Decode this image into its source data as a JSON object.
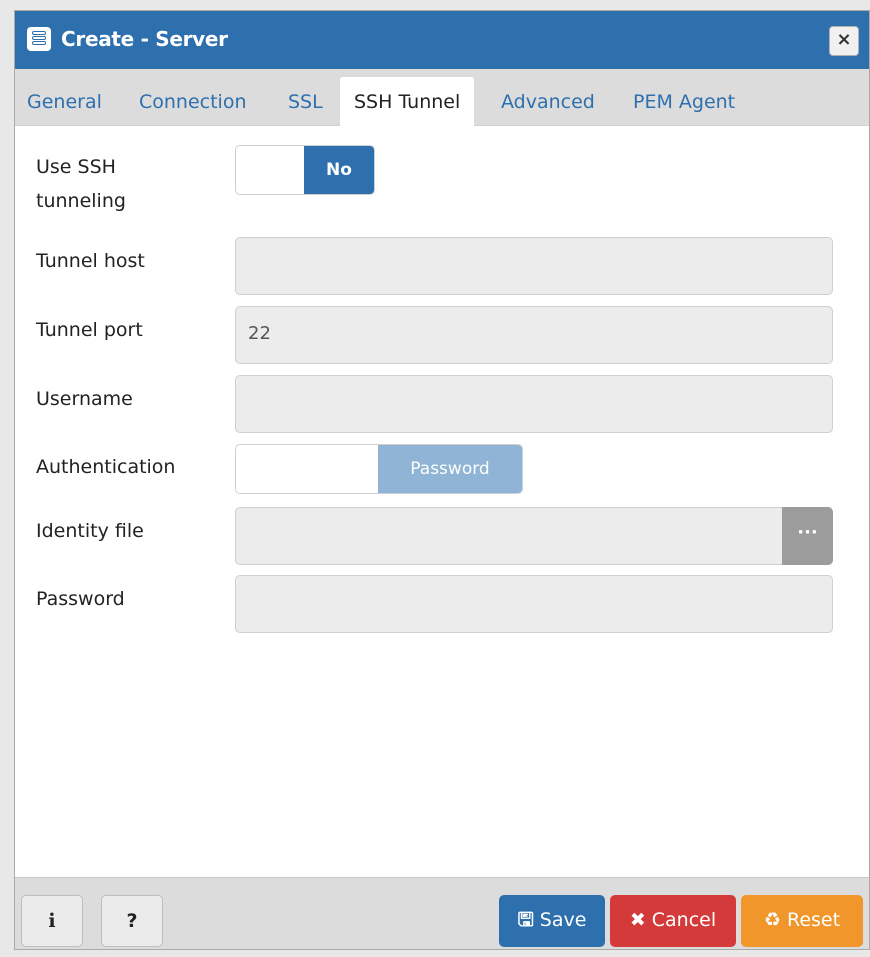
{
  "dialog": {
    "title": "Create - Server",
    "close_glyph": "×"
  },
  "tabs": [
    {
      "label": "General"
    },
    {
      "label": "Connection"
    },
    {
      "label": "SSL"
    },
    {
      "label": "SSH Tunnel",
      "active": true
    },
    {
      "label": "Advanced"
    },
    {
      "label": "PEM Agent"
    }
  ],
  "form": {
    "use_ssh": {
      "label_line1": "Use SSH",
      "label_line2": "tunneling",
      "value": "No"
    },
    "tunnel_host": {
      "label": "Tunnel host",
      "value": ""
    },
    "tunnel_port": {
      "label": "Tunnel port",
      "value": "22"
    },
    "username": {
      "label": "Username",
      "value": ""
    },
    "authentication": {
      "label": "Authentication",
      "value": "Password"
    },
    "identity_file": {
      "label": "Identity file",
      "value": "",
      "browse_glyph": "···"
    },
    "password": {
      "label": "Password",
      "value": ""
    }
  },
  "footer": {
    "info_glyph": "i",
    "help_glyph": "?",
    "save_label": "Save",
    "cancel_label": "Cancel",
    "reset_label": "Reset",
    "save_icon_glyph": "🖫",
    "cancel_icon_glyph": "✖",
    "reset_icon_glyph": "♻"
  },
  "colors": {
    "accent": "#2e6fae",
    "toggle_disabled": "#8fb4d6",
    "cancel": "#d43a3a",
    "reset": "#f0962a"
  }
}
